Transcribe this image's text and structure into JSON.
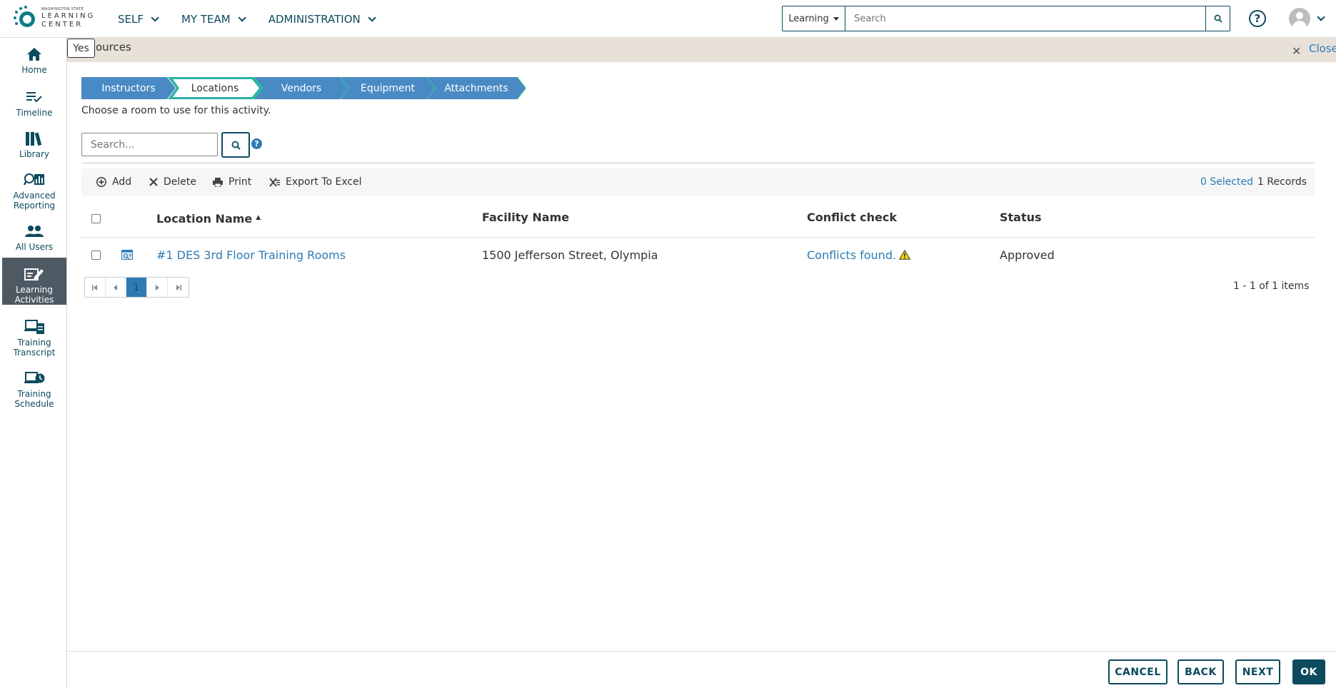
{
  "logo": {
    "line1": "WASHINGTON STATE",
    "line2": "LEARNING",
    "line3": "CENTER"
  },
  "nav": {
    "items": [
      {
        "label": "SELF"
      },
      {
        "label": "MY TEAM"
      },
      {
        "label": "ADMINISTRATION"
      }
    ]
  },
  "global_search": {
    "category": "Learning",
    "placeholder": "Search"
  },
  "sidebar": {
    "items": [
      {
        "label": "Home",
        "icon": "home-icon"
      },
      {
        "label": "Timeline",
        "icon": "timeline-icon"
      },
      {
        "label": "Library",
        "icon": "library-icon"
      },
      {
        "label": "Advanced Reporting",
        "icon": "reporting-icon"
      },
      {
        "label": "All Users",
        "icon": "users-icon"
      },
      {
        "label": "Learning Activities",
        "icon": "learning-activities-icon"
      },
      {
        "label": "Training Transcript",
        "icon": "transcript-icon"
      },
      {
        "label": "Training Schedule",
        "icon": "schedule-icon"
      }
    ],
    "active_index": 5
  },
  "resources": {
    "title": "ources",
    "close_label": "Close",
    "tooltip": "Yes"
  },
  "steps": {
    "items": [
      {
        "label": "Instructors"
      },
      {
        "label": "Locations"
      },
      {
        "label": "Vendors"
      },
      {
        "label": "Equipment"
      },
      {
        "label": "Attachments"
      }
    ],
    "active_index": 1,
    "colors": {
      "inactive": "#4a8ac4",
      "active_border": "#2ab3a6"
    }
  },
  "subtitle": "Choose a room to use for this activity.",
  "table_search": {
    "placeholder": "Search..."
  },
  "toolbar": {
    "add": "Add",
    "delete": "Delete",
    "print": "Print",
    "export": "Export To Excel",
    "selected": "0 Selected",
    "records": "1 Records"
  },
  "grid": {
    "columns": {
      "location": "Location Name",
      "facility": "Facility Name",
      "conflict": "Conflict check",
      "status": "Status"
    },
    "rows": [
      {
        "location": "#1 DES 3rd Floor Training Rooms",
        "facility": "1500 Jefferson Street, Olympia",
        "conflict": "Conflicts found.",
        "status": "Approved"
      }
    ]
  },
  "pager": {
    "current_page": "1",
    "info": "1 - 1 of 1 items"
  },
  "footer": {
    "cancel": "CANCEL",
    "back": "BACK",
    "next": "NEXT",
    "ok": "OK"
  }
}
